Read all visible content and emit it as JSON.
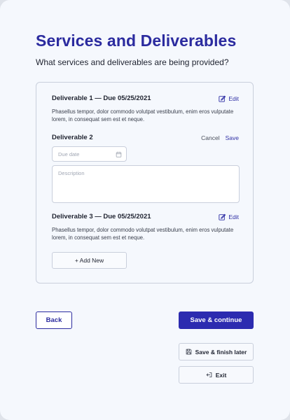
{
  "page": {
    "title": "Services and Deliverables",
    "subtitle": "What services and deliverables are being provided?"
  },
  "deliverables": [
    {
      "title": "Deliverable 1 — Due 05/25/2021",
      "description": "Phasellus tempor, dolor commodo volutpat vestibulum, enim eros vulputate lorem, in consequat sem est et neque.",
      "edit_label": "Edit",
      "edit_icon": "edit-icon"
    },
    {
      "title": "Deliverable 2",
      "cancel_label": "Cancel",
      "save_label": "Save",
      "due_date_placeholder": "Due date",
      "calendar_icon": "calendar-icon",
      "description_placeholder": "Description"
    },
    {
      "title": "Deliverable 3 — Due 05/25/2021",
      "description": "Phasellus tempor, dolor commodo volutpat vestibulum, enim eros vulputate lorem, in consequat sem est et neque.",
      "edit_label": "Edit",
      "edit_icon": "edit-icon"
    }
  ],
  "add_new_label": "+ Add New",
  "footer": {
    "back_label": "Back",
    "save_continue_label": "Save & continue",
    "save_finish_later_label": "Save & finish later",
    "save_icon": "save-icon",
    "exit_label": "Exit",
    "exit_icon": "exit-icon"
  },
  "colors": {
    "accent": "#2b2b9f",
    "primary_button": "#2c2bb0",
    "background": "#f5f8fd",
    "border": "#c9cfdc"
  }
}
